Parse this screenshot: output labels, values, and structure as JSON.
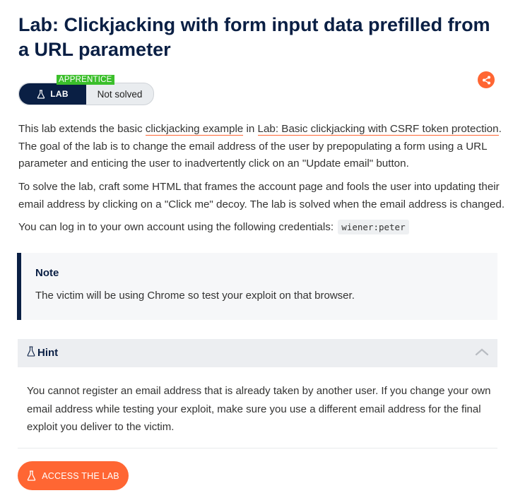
{
  "title": "Lab: Clickjacking with form input data prefilled from a URL parameter",
  "badge": {
    "lab_label": "LAB",
    "level": "APPRENTICE",
    "status": "Not solved",
    "icon": "flask-icon"
  },
  "share_icon": "share-icon",
  "intro": {
    "text_1": "This lab extends the basic ",
    "link_1": "clickjacking example",
    "text_2": " in ",
    "link_2": "Lab: Basic clickjacking with CSRF token protection",
    "text_3": ". The goal of the lab is to change the email address of the user by prepopulating a form using a URL parameter and enticing the user to inadvertently click on an \"Update email\" button."
  },
  "solve_text": "To solve the lab, craft some HTML that frames the account page and fools the user into updating their email address by clicking on a \"Click me\" decoy. The lab is solved when the email address is changed.",
  "credentials": {
    "text": "You can log in to your own account using the following credentials: ",
    "code": "wiener:peter"
  },
  "note": {
    "title": "Note",
    "body": "The victim will be using Chrome so test your exploit on that browser."
  },
  "hint": {
    "label": "Hint",
    "icon": "flask-icon",
    "expanded": true,
    "body": "You cannot register an email address that is already taken by another user. If you change your own email address while testing your exploit, make sure you use a different email address for the final exploit you deliver to the victim."
  },
  "access_button": {
    "label": "ACCESS THE LAB",
    "icon": "flask-icon"
  },
  "colors": {
    "navy": "#0a1f44",
    "accent": "#ff6633",
    "apprentice": "#3bbf2b"
  }
}
